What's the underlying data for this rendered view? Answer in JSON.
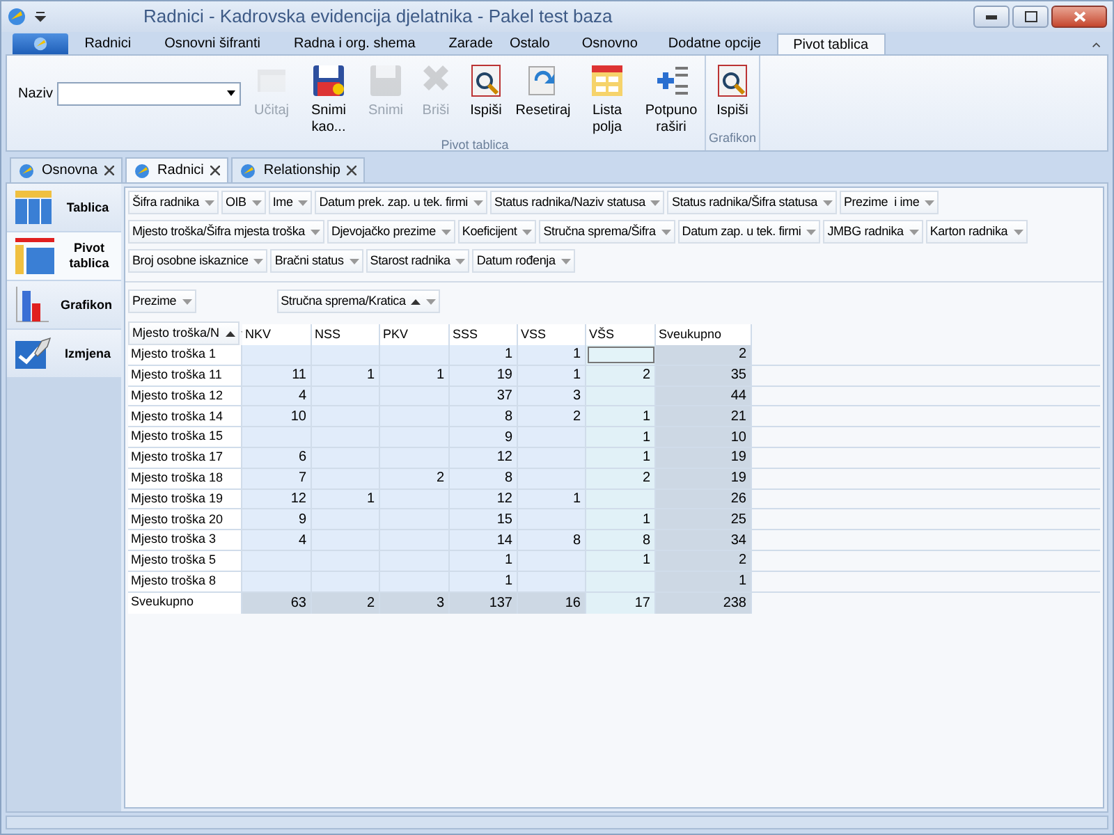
{
  "window": {
    "title": "Radnici - Kadrovska evidencija djelatnika - Pakel test baza"
  },
  "ribbon_tabs": [
    {
      "label": "Radnici",
      "selected": false
    },
    {
      "label": "Osnovni šifranti",
      "selected": false
    },
    {
      "label": "Radna i org. shema",
      "selected": false
    },
    {
      "label": "Zarade",
      "selected": false
    }
  ],
  "context_group": {
    "label": "Ostalo",
    "tabs": [
      {
        "label": "Osnovno",
        "selected": false
      },
      {
        "label": "Dodatne opcije",
        "selected": false
      },
      {
        "label": "Pivot tablica",
        "selected": true
      }
    ]
  },
  "ribbon": {
    "naziv_label": "Naziv",
    "groups": [
      {
        "label": "Pivot tablica",
        "buttons": [
          {
            "label": "Učitaj",
            "kind": "open",
            "disabled": true
          },
          {
            "label": "Snimi kao...",
            "kind": "saveas",
            "disabled": false
          },
          {
            "label": "Snimi",
            "kind": "save",
            "disabled": true
          },
          {
            "label": "Briši",
            "kind": "delete",
            "disabled": true
          },
          {
            "label": "Ispiši",
            "kind": "print",
            "disabled": false
          },
          {
            "label": "Resetiraj",
            "kind": "reset",
            "disabled": false
          },
          {
            "label": "Lista polja",
            "kind": "fields",
            "disabled": false
          },
          {
            "label": "Potpuno raširi",
            "kind": "expand",
            "disabled": false
          }
        ]
      },
      {
        "label": "Grafikon",
        "buttons": [
          {
            "label": "Ispiši",
            "kind": "print",
            "disabled": false
          }
        ]
      }
    ]
  },
  "document_tabs": [
    {
      "label": "Osnovna",
      "selected": false
    },
    {
      "label": "Radnici",
      "selected": true
    },
    {
      "label": "Relationship",
      "selected": false
    }
  ],
  "nav": [
    {
      "label": "Tablica",
      "kind": "table",
      "selected": false
    },
    {
      "label": "Pivot tablica",
      "kind": "pivot",
      "selected": true
    },
    {
      "label": "Grafikon",
      "kind": "chart",
      "selected": false
    },
    {
      "label": "Izmjena",
      "kind": "edit",
      "selected": false
    }
  ],
  "pivot": {
    "field_list": [
      {
        "label": "Šifra radnika"
      },
      {
        "label": "OIB"
      },
      {
        "label": "Ime"
      },
      {
        "label": "Datum prek. zap. u tek. firmi"
      },
      {
        "label": "Status radnika/Naziv statusa"
      },
      {
        "label": "Status radnika/Šifra statusa"
      },
      {
        "label": "Prezime  i ime"
      },
      {
        "label": "Mjesto troška/Šifra mjesta troška"
      },
      {
        "label": "Djevojačko prezime"
      },
      {
        "label": "Koeficijent"
      },
      {
        "label": "Stručna sprema/Šifra"
      },
      {
        "label": "Datum zap. u tek. firmi"
      },
      {
        "label": "JMBG radnika"
      },
      {
        "label": "Karton radnika"
      },
      {
        "label": "Broj osobne iskaznice"
      },
      {
        "label": "Bračni status"
      },
      {
        "label": "Starost radnika"
      },
      {
        "label": "Datum rođenja"
      }
    ],
    "filter_field": {
      "label": "Prezime"
    },
    "column_field": {
      "label": "Stručna sprema/Kratica",
      "sorted": true
    },
    "row_field": {
      "label": "Mjesto troška/N",
      "sorted": true
    },
    "columns": [
      "NKV",
      "NSS",
      "PKV",
      "SSS",
      "VSS",
      "VŠS",
      "Sveukupno"
    ],
    "rows": [
      {
        "label": "Mjesto troška 1",
        "cells": [
          {
            "selected": false
          },
          {
            "selected": false
          },
          {
            "selected": false
          },
          {
            "value": "1",
            "selected": false
          },
          {
            "value": "1",
            "selected": false
          },
          {
            "selected": true
          },
          {
            "value": "2",
            "selected": false
          }
        ]
      },
      {
        "label": "Mjesto troška 11",
        "cells": [
          {
            "value": "11",
            "selected": false
          },
          {
            "value": "1",
            "selected": false
          },
          {
            "value": "1",
            "selected": false
          },
          {
            "value": "19",
            "selected": false
          },
          {
            "value": "1",
            "selected": false
          },
          {
            "value": "2",
            "selected": false
          },
          {
            "value": "35",
            "selected": false
          }
        ]
      },
      {
        "label": "Mjesto troška 12",
        "cells": [
          {
            "value": "4",
            "selected": false
          },
          {
            "selected": false
          },
          {
            "selected": false
          },
          {
            "value": "37",
            "selected": false
          },
          {
            "value": "3",
            "selected": false
          },
          {
            "selected": false
          },
          {
            "value": "44",
            "selected": false
          }
        ]
      },
      {
        "label": "Mjesto troška 14",
        "cells": [
          {
            "value": "10",
            "selected": false
          },
          {
            "selected": false
          },
          {
            "selected": false
          },
          {
            "value": "8",
            "selected": false
          },
          {
            "value": "2",
            "selected": false
          },
          {
            "value": "1",
            "selected": false
          },
          {
            "value": "21",
            "selected": false
          }
        ]
      },
      {
        "label": "Mjesto troška 15",
        "cells": [
          {
            "selected": false
          },
          {
            "selected": false
          },
          {
            "selected": false
          },
          {
            "value": "9",
            "selected": false
          },
          {
            "selected": false
          },
          {
            "value": "1",
            "selected": false
          },
          {
            "value": "10",
            "selected": false
          }
        ]
      },
      {
        "label": "Mjesto troška 17",
        "cells": [
          {
            "value": "6",
            "selected": false
          },
          {
            "selected": false
          },
          {
            "selected": false
          },
          {
            "value": "12",
            "selected": false
          },
          {
            "selected": false
          },
          {
            "value": "1",
            "selected": false
          },
          {
            "value": "19",
            "selected": false
          }
        ]
      },
      {
        "label": "Mjesto troška 18",
        "cells": [
          {
            "value": "7",
            "selected": false
          },
          {
            "selected": false
          },
          {
            "value": "2",
            "selected": false
          },
          {
            "value": "8",
            "selected": false
          },
          {
            "selected": false
          },
          {
            "value": "2",
            "selected": false
          },
          {
            "value": "19",
            "selected": false
          }
        ]
      },
      {
        "label": "Mjesto troška 19",
        "cells": [
          {
            "value": "12",
            "selected": false
          },
          {
            "value": "1",
            "selected": false
          },
          {
            "selected": false
          },
          {
            "value": "12",
            "selected": false
          },
          {
            "value": "1",
            "selected": false
          },
          {
            "selected": false
          },
          {
            "value": "26",
            "selected": false
          }
        ]
      },
      {
        "label": "Mjesto troška 20",
        "cells": [
          {
            "value": "9",
            "selected": false
          },
          {
            "selected": false
          },
          {
            "selected": false
          },
          {
            "value": "15",
            "selected": false
          },
          {
            "selected": false
          },
          {
            "value": "1",
            "selected": false
          },
          {
            "value": "25",
            "selected": false
          }
        ]
      },
      {
        "label": "Mjesto troška 3",
        "cells": [
          {
            "value": "4",
            "selected": false
          },
          {
            "selected": false
          },
          {
            "selected": false
          },
          {
            "value": "14",
            "selected": false
          },
          {
            "value": "8",
            "selected": false
          },
          {
            "value": "8",
            "selected": false
          },
          {
            "value": "34",
            "selected": false
          }
        ]
      },
      {
        "label": "Mjesto troška 5",
        "cells": [
          {
            "selected": false
          },
          {
            "selected": false
          },
          {
            "selected": false
          },
          {
            "value": "1",
            "selected": false
          },
          {
            "selected": false
          },
          {
            "value": "1",
            "selected": false
          },
          {
            "value": "2",
            "selected": false
          }
        ]
      },
      {
        "label": "Mjesto troška 8",
        "cells": [
          {
            "selected": false
          },
          {
            "selected": false
          },
          {
            "selected": false
          },
          {
            "value": "1",
            "selected": false
          },
          {
            "selected": false
          },
          {
            "selected": false
          },
          {
            "value": "1",
            "selected": false
          }
        ]
      }
    ],
    "total_row": {
      "label": "Sveukupno",
      "cells": [
        {
          "value": "63",
          "selected": false
        },
        {
          "value": "2",
          "selected": false
        },
        {
          "value": "3",
          "selected": false
        },
        {
          "value": "137",
          "selected": false
        },
        {
          "value": "16",
          "selected": false
        },
        {
          "value": "17",
          "selected": false
        },
        {
          "value": "238",
          "selected": false
        }
      ]
    }
  }
}
